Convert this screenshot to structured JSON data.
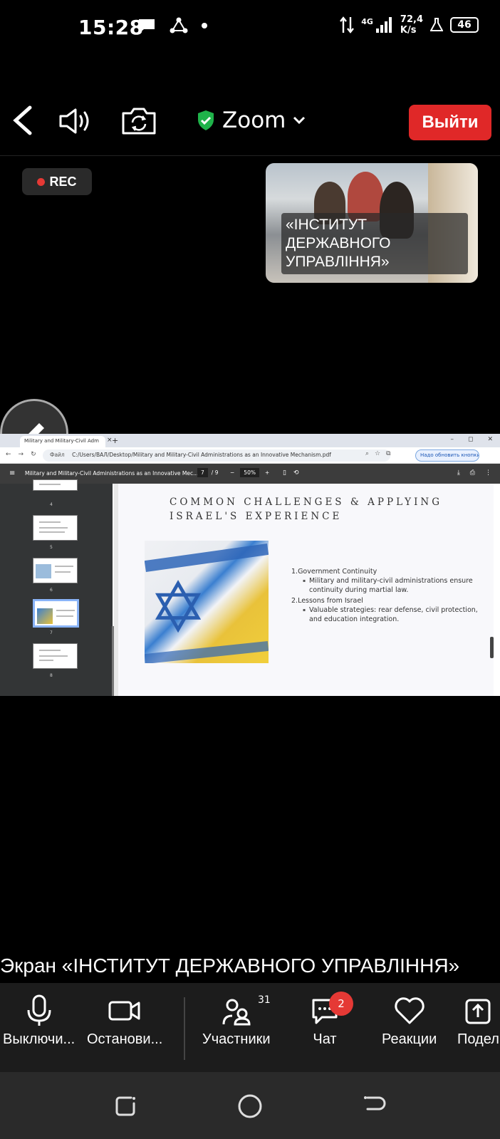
{
  "status_bar": {
    "time": "15:28",
    "network_type": "4G",
    "speed_value": "72,4",
    "speed_unit": "K/s",
    "battery": "46"
  },
  "zoom_header": {
    "title": "Zoom",
    "exit_label": "Выйти"
  },
  "recording": {
    "label": "REC"
  },
  "video_tile": {
    "name": "«ІНСТИТУТ ДЕРЖАВНОГО УПРАВЛІННЯ»"
  },
  "shared_screen": {
    "browser": {
      "tab_title": "Military and Military-Civil Adm",
      "url_label": "Файл",
      "url": "C:/Users/ВАЛ/Desktop/Military and Military-Civil Administrations as an Innovative Mechanism.pdf",
      "update_label": "Надо обновить кнопки Chrome"
    },
    "pdf_viewer": {
      "title": "Military and Military-Civil Administrations as an Innovative Mec...",
      "current_page": "7",
      "total_pages": "/ 9",
      "zoom": "50%"
    },
    "thumbnails": [
      "4",
      "5",
      "6",
      "7",
      "8"
    ],
    "slide": {
      "title_line1": "COMMON CHALLENGES & APPLYING",
      "title_line2": "ISRAEL'S EXPERIENCE",
      "item1": "1.Government Continuity",
      "item1_sub": "Military and military-civil administrations ensure continuity during martial law.",
      "item2": "2.Lessons from Israel",
      "item2_sub": "Valuable strategies: rear defense, civil protection, and education integration."
    }
  },
  "screen_label": "Экран «ІНСТИТУТ ДЕРЖАВНОГО УПРАВЛІННЯ»",
  "toolbar": {
    "mic": "Выключи...",
    "video": "Останови...",
    "participants": "Участники",
    "participants_count": "31",
    "chat": "Чат",
    "chat_badge": "2",
    "reactions": "Реакции",
    "share": "Подел"
  }
}
